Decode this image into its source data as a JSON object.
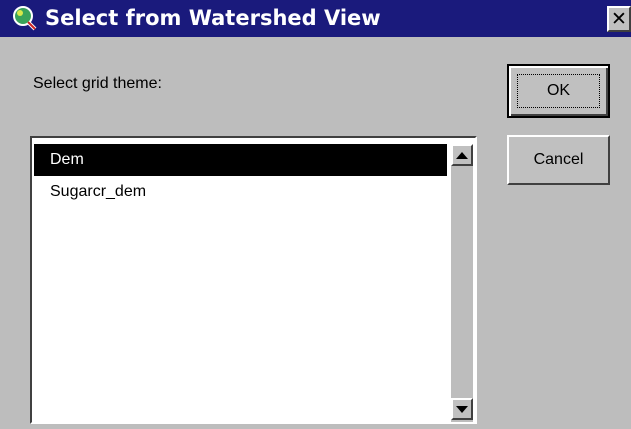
{
  "window": {
    "title": "Select from Watershed View",
    "close_glyph": "✕",
    "icon": "magnifier-globe-icon"
  },
  "prompt": "Select grid theme:",
  "list": {
    "items": [
      "Dem",
      "Sugarcr_dem"
    ],
    "selected": "Dem"
  },
  "buttons": {
    "ok": "OK",
    "cancel": "Cancel"
  },
  "colors": {
    "titlebar": "#1a1a7c",
    "dialog_bg": "#bdbdbd",
    "selection": "#000000"
  }
}
